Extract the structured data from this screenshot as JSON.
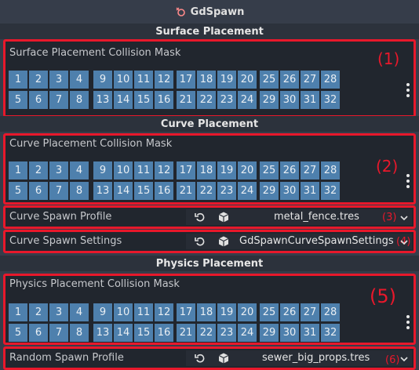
{
  "header": {
    "title": "GdSpawn",
    "icon": "gdspawn-node-icon"
  },
  "sections": {
    "surface": "Surface Placement",
    "curve": "Curve Placement",
    "physics": "Physics Placement"
  },
  "masks": {
    "surface": {
      "label": "Surface Placement Collision Mask",
      "annotation": "(1)"
    },
    "curve": {
      "label": "Curve Placement Collision Mask",
      "annotation": "(2)"
    },
    "physics": {
      "label": "Physics Placement Collision Mask",
      "annotation": "(5)"
    }
  },
  "bits": {
    "row1": [
      "1",
      "2",
      "3",
      "4",
      "9",
      "10",
      "11",
      "12",
      "17",
      "18",
      "19",
      "20",
      "25",
      "26",
      "27",
      "28"
    ],
    "row2": [
      "5",
      "6",
      "7",
      "8",
      "13",
      "14",
      "15",
      "16",
      "21",
      "22",
      "23",
      "24",
      "29",
      "30",
      "31",
      "32"
    ]
  },
  "properties": {
    "curve_spawn_profile": {
      "label": "Curve Spawn Profile",
      "value": "metal_fence.tres",
      "annotation": "(3)"
    },
    "curve_spawn_settings": {
      "label": "Curve Spawn Settings",
      "value": "GdSpawnCurveSpawnSettings",
      "annotation": "(4)"
    },
    "random_spawn_profile": {
      "label": "Random Spawn Profile",
      "value": "sewer_big_props.tres",
      "annotation": "(6)"
    }
  },
  "colors": {
    "highlight": "#e8182b",
    "bit_active": "#4e80ad",
    "panel": "#21262e",
    "background": "#363d4a"
  }
}
